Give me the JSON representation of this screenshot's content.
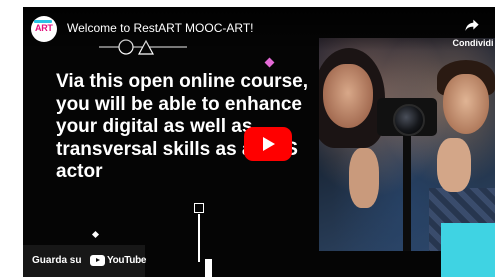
{
  "video": {
    "title": "Welcome to RestART MOOC-ART!",
    "channel_avatar_text": "ART",
    "share_label": "Condividi",
    "headline": "Via this open online course, you will be able to enhance your digital as well as transversal skills as a CCS actor",
    "play_icon": "play-icon",
    "share_icon": "share-arrow-icon"
  },
  "watch_on": {
    "label": "Guarda su",
    "logo_text": "YouTube"
  },
  "colors": {
    "player_bg": "#050505",
    "play_red": "#ff0000",
    "accent_cyan": "#3fd3e3",
    "accent_pink": "#e46ad6",
    "brand_pink": "#e2117d"
  }
}
